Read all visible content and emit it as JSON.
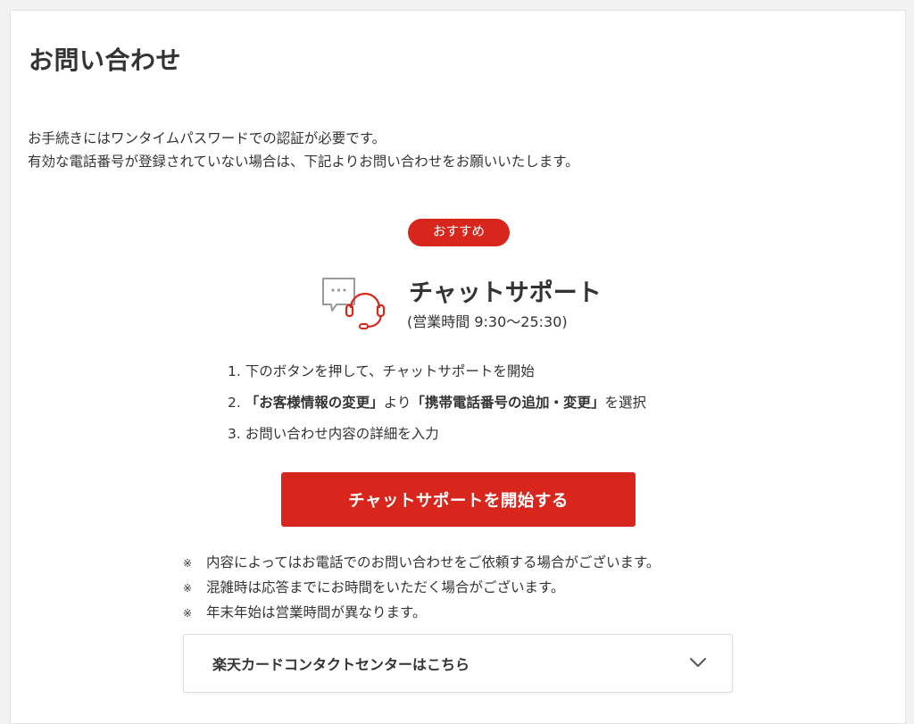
{
  "page": {
    "title": "お問い合わせ",
    "intro_line1": "お手続きにはワンタイムパスワードでの認証が必要です。",
    "intro_line2": "有効な電話番号が登録されていない場合は、下記よりお問い合わせをお願いいたします。"
  },
  "chat_support": {
    "badge": "おすすめ",
    "icon": "chat-headset-icon",
    "title": "チャットサポート",
    "hours": "(営業時間 9:30〜25:30)",
    "steps": [
      {
        "num": "1.",
        "text": "下のボタンを押して、チャットサポートを開始"
      },
      {
        "num": "2.",
        "pre": "",
        "bold1": "「お客様情報の変更」",
        "mid": "より",
        "bold2": "「携帯電話番号の追加・変更」",
        "post": "を選択"
      },
      {
        "num": "3.",
        "text": "お問い合わせ内容の詳細を入力"
      }
    ],
    "button_label": "チャットサポートを開始する",
    "note_mark": "※",
    "notes": [
      "内容によってはお電話でのお問い合わせをご依頼する場合がございます。",
      "混雑時は応答までにお時間をいただく場合がございます。",
      "年末年始は営業時間が異なります。"
    ]
  },
  "contact_center": {
    "label": "楽天カードコンタクトセンターはこちら",
    "icon": "chevron-down-icon"
  },
  "colors": {
    "accent": "#d9261c",
    "text": "#333333",
    "background": "#f2f2f2"
  }
}
